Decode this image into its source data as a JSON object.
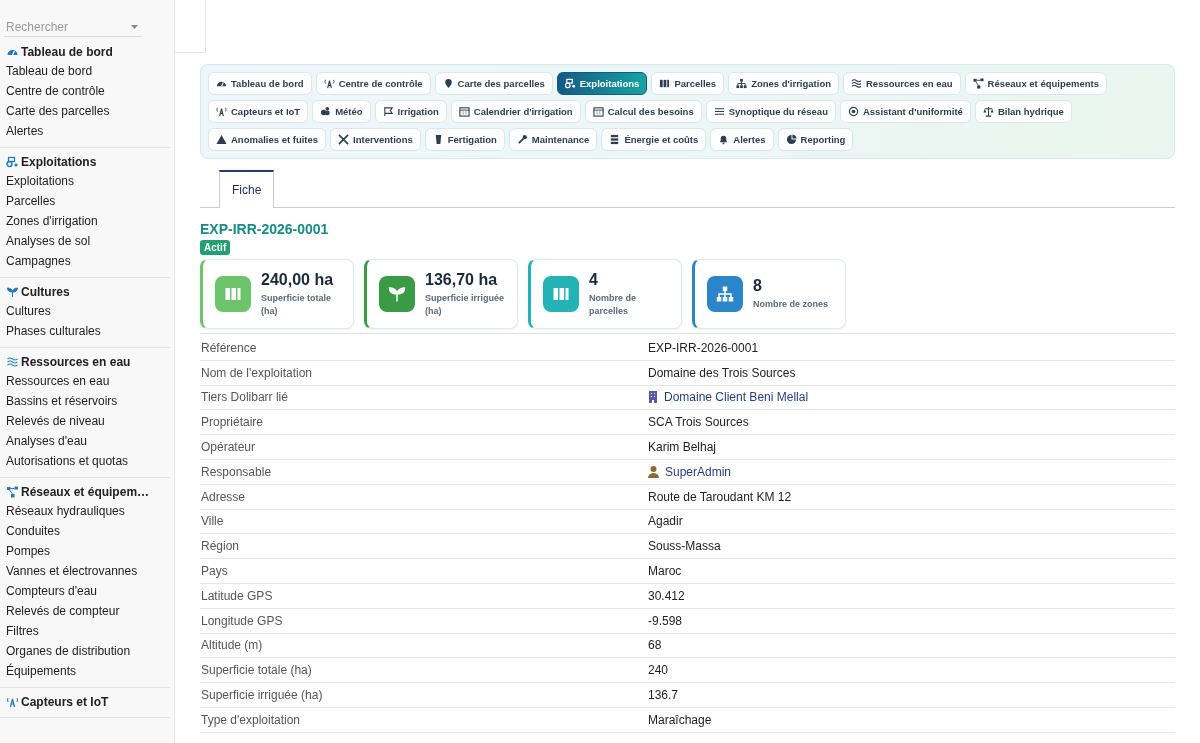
{
  "sidebar": {
    "search": {
      "placeholder": "Rechercher"
    },
    "sections": [
      {
        "title": "Tableau de bord",
        "items": [
          "Tableau de bord",
          "Centre de contrôle",
          "Carte des parcelles",
          "Alertes"
        ]
      },
      {
        "title": "Exploitations",
        "items": [
          "Exploitations",
          "Parcelles",
          "Zones d'irrigation",
          "Analyses de sol",
          "Campagnes"
        ]
      },
      {
        "title": "Cultures",
        "items": [
          "Cultures",
          "Phases culturales"
        ]
      },
      {
        "title": "Ressources en eau",
        "items": [
          "Ressources en eau",
          "Bassins et réservoirs",
          "Relevés de niveau",
          "Analyses d'eau",
          "Autorisations et quotas"
        ]
      },
      {
        "title": "Réseaux et équipem…",
        "items": [
          "Réseaux hydrauliques",
          "Conduites",
          "Pompes",
          "Vannes et électrovannes",
          "Compteurs d'eau",
          "Relevés de compteur",
          "Filtres",
          "Organes de distribution",
          "Équipements"
        ]
      },
      {
        "title": "Capteurs et IoT"
      }
    ]
  },
  "nav": [
    {
      "label": "Tableau de bord",
      "selected": false
    },
    {
      "label": "Centre de contrôle",
      "selected": false
    },
    {
      "label": "Carte des parcelles",
      "selected": false
    },
    {
      "label": "Exploitations",
      "selected": true
    },
    {
      "label": "Parcelles",
      "selected": false
    },
    {
      "label": "Zones d'irrigation",
      "selected": false
    },
    {
      "label": "Ressources en eau",
      "selected": false
    },
    {
      "label": "Réseaux et équipements",
      "selected": false
    },
    {
      "label": "Capteurs et IoT",
      "selected": false
    },
    {
      "label": "Météo",
      "selected": false
    },
    {
      "label": "Irrigation",
      "selected": false
    },
    {
      "label": "Calendrier d'irrigation",
      "selected": false
    },
    {
      "label": "Calcul des besoins",
      "selected": false
    },
    {
      "label": "Synoptique du réseau",
      "selected": false
    },
    {
      "label": "Assistant d'uniformité",
      "selected": false
    },
    {
      "label": "Bilan hydrique",
      "selected": false
    },
    {
      "label": "Anomalies et fuites",
      "selected": false
    },
    {
      "label": "Interventions",
      "selected": false
    },
    {
      "label": "Fertigation",
      "selected": false
    },
    {
      "label": "Maintenance",
      "selected": false
    },
    {
      "label": "Énergie et coûts",
      "selected": false
    },
    {
      "label": "Alertes",
      "selected": false
    },
    {
      "label": "Reporting",
      "selected": false
    }
  ],
  "tabs": [
    {
      "label": "Fiche",
      "selected": true
    }
  ],
  "record": {
    "title": "EXP-IRR-2026-0001",
    "status": "Actif"
  },
  "cards": [
    {
      "value": "240,00 ha",
      "label": "Superficie totale (ha)",
      "color": "#6cc36c"
    },
    {
      "value": "136,70 ha",
      "label": "Superficie irriguée (ha)",
      "color": "#3a9a45"
    },
    {
      "value": "4",
      "label": "Nombre de parcelles",
      "color": "#23b2b5"
    },
    {
      "value": "8",
      "label": "Nombre de zones",
      "color": "#2a86c8"
    }
  ],
  "fields": [
    {
      "label": "Référence",
      "value": "EXP-IRR-2026-0001",
      "kind": "text"
    },
    {
      "label": "Nom de l'exploitation",
      "value": "Domaine des Trois Sources",
      "kind": "text"
    },
    {
      "label": "Tiers Dolibarr lié",
      "value": "Domaine Client Beni Mellal",
      "kind": "company"
    },
    {
      "label": "Propriétaire",
      "value": "SCA Trois Sources",
      "kind": "text"
    },
    {
      "label": "Opérateur",
      "value": "Karim Belhaj",
      "kind": "text"
    },
    {
      "label": "Responsable",
      "value": "SuperAdmin",
      "kind": "user"
    },
    {
      "label": "Adresse",
      "value": "Route de Taroudant KM 12",
      "kind": "text"
    },
    {
      "label": "Ville",
      "value": "Agadir",
      "kind": "text"
    },
    {
      "label": "Région",
      "value": "Souss-Massa",
      "kind": "text"
    },
    {
      "label": "Pays",
      "value": "Maroc",
      "kind": "text"
    },
    {
      "label": "Latitude GPS",
      "value": "30.412",
      "kind": "text"
    },
    {
      "label": "Longitude GPS",
      "value": "-9.598",
      "kind": "text"
    },
    {
      "label": "Altitude (m)",
      "value": "68",
      "kind": "text"
    },
    {
      "label": "Superficie totale (ha)",
      "value": "240",
      "kind": "text"
    },
    {
      "label": "Superficie irriguée (ha)",
      "value": "136.7",
      "kind": "text"
    },
    {
      "label": "Type d'exploitation",
      "value": "Maraîchage",
      "kind": "text"
    }
  ]
}
